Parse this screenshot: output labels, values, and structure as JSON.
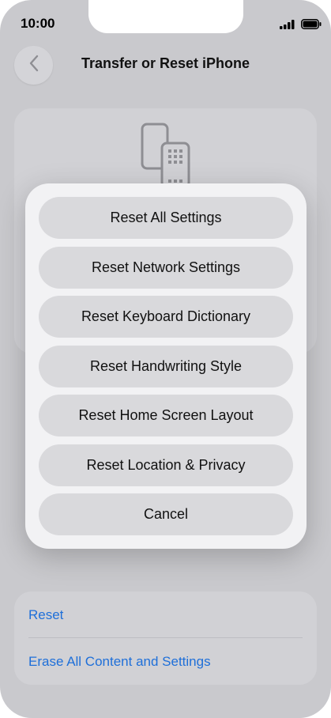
{
  "status_bar": {
    "time": "10:00"
  },
  "header": {
    "title": "Transfer or Reset iPhone"
  },
  "icons": {
    "back": "chevron-left-icon",
    "device": "phone-and-keypad-icon",
    "signal": "cellular-signal-icon",
    "battery": "battery-icon"
  },
  "action_sheet": {
    "items": [
      {
        "label": "Reset All Settings"
      },
      {
        "label": "Reset Network Settings"
      },
      {
        "label": "Reset Keyboard Dictionary"
      },
      {
        "label": "Reset Handwriting Style"
      },
      {
        "label": "Reset Home Screen Layout"
      },
      {
        "label": "Reset Location & Privacy"
      }
    ],
    "cancel_label": "Cancel"
  },
  "bottom_list": {
    "reset_label": "Reset",
    "erase_label": "Erase All Content and Settings"
  },
  "colors": {
    "link": "#1e6fd9",
    "background_dim": "#c9c9cd",
    "sheet": "#f2f2f4",
    "sheet_button": "#d9d9dc"
  }
}
